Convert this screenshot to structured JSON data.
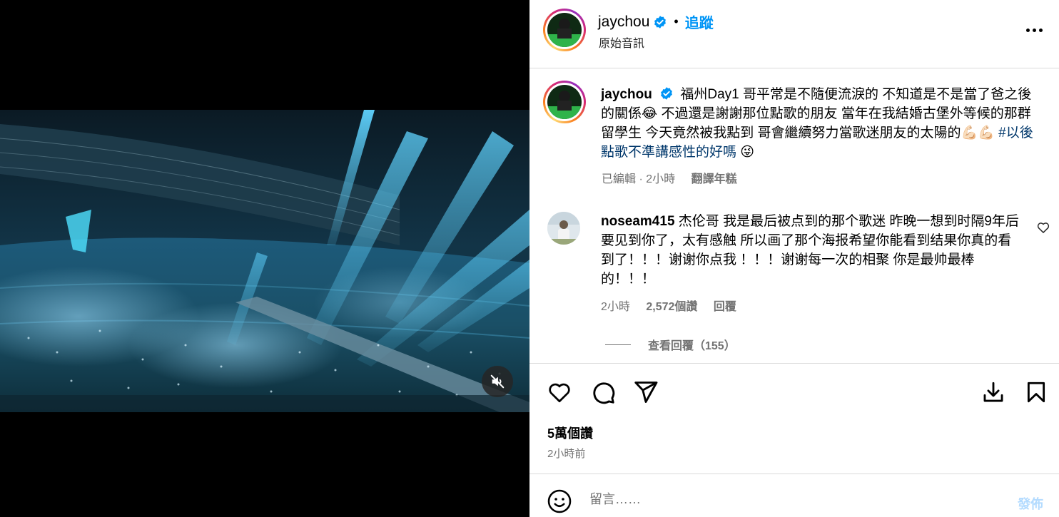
{
  "header": {
    "username": "jaychou",
    "separator": "•",
    "follow_label": "追蹤",
    "audio_label": "原始音訊"
  },
  "caption": {
    "username": "jaychou",
    "text": "福州Day1 哥平常是不隨便流淚的 不知道是不是當了爸之後的關係😂 不過還是謝謝那位點歌的朋友 當年在我結婚古堡外等候的那群留學生 今天竟然被我點到 哥會繼續努力當歌迷朋友的太陽的💪🏻💪🏻 ",
    "hashtag": "#以後點歌不準講感性的好嗎",
    "hashtag_emoji": "😜",
    "edited": "已編輯",
    "time": "· 2小時",
    "translate_label": "翻譯年糕"
  },
  "comment": {
    "username": "noseam415",
    "text": "杰伦哥 我是最后被点到的那个歌迷 昨晚一想到时隔9年后要见到你了，太有感触 所以画了那个海报希望你能看到结果你真的看到了！！！谢谢你点我 ！！！谢谢每一次的相聚 你是最帅最棒的！！！",
    "time": "2小時",
    "likes": "2,572個讚",
    "reply_label": "回覆",
    "view_replies": "查看回覆（155）"
  },
  "post": {
    "likes": "5萬個讚",
    "time": "2小時前"
  },
  "composer": {
    "placeholder": "留言……",
    "post_label": "發佈"
  },
  "icons": {
    "verified": "verified-badge-icon",
    "more": "more-options-icon",
    "like": "heart-icon",
    "comment": "comment-icon",
    "share": "share-icon",
    "save": "download-icon",
    "bookmark": "bookmark-icon",
    "emoji": "emoji-icon",
    "mute": "muted-speaker-icon"
  },
  "colors": {
    "accent": "#0095f6",
    "hashtag": "#00376b",
    "secondary_text": "#737373",
    "post_button_disabled": "#b3dbff"
  }
}
